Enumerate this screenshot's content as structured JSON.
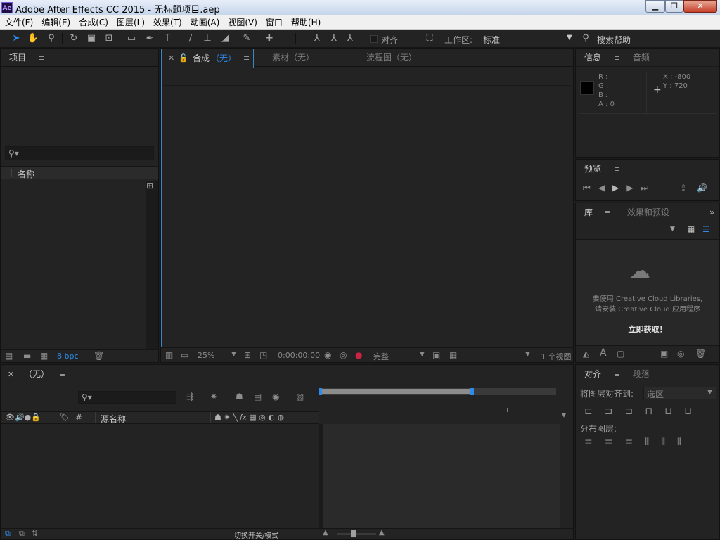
{
  "window": {
    "logo": "Ae",
    "title": "Adobe After Effects CC 2015 - 无标题项目.aep"
  },
  "menu": [
    "文件(F)",
    "编辑(E)",
    "合成(C)",
    "图层(L)",
    "效果(T)",
    "动画(A)",
    "视图(V)",
    "窗口",
    "帮助(H)"
  ],
  "toolbar": {
    "snap_label": "对齐",
    "workspace_label": "工作区:",
    "workspace_value": "标准",
    "search_placeholder": "搜索帮助"
  },
  "project": {
    "title": "项目",
    "col_name": "名称",
    "bpc": "8 bpc"
  },
  "viewer": {
    "tabs": [
      {
        "label": "合成",
        "suffix": "（无）"
      },
      {
        "label": "素材（无）"
      },
      {
        "label": "流程图（无）"
      }
    ],
    "zoom": "25%",
    "timecode": "0:00:00:00",
    "resolution": "完整",
    "views": "1 个视图"
  },
  "info": {
    "tabs": [
      "信息",
      "音频"
    ],
    "r": "R :",
    "g": "G :",
    "b": "B :",
    "a": "A : 0",
    "x": "X : -800",
    "y": "Y : 720"
  },
  "preview": {
    "title": "预览"
  },
  "library": {
    "tabs": [
      "库",
      "效果和预设"
    ],
    "message_line1": "要使用 Creative Cloud Libraries,",
    "message_line2": "请安装 Creative Cloud 应用程序",
    "link": "立即获取！"
  },
  "timeline": {
    "title": "（无）",
    "col_hash": "#",
    "col_source": "源名称",
    "footer_toggle": "切换开关/模式"
  },
  "align": {
    "tabs": [
      "对齐",
      "段落"
    ],
    "align_to_label": "将图层对齐到:",
    "align_to_value": "选区",
    "distribute_label": "分布图层:"
  },
  "colors": {
    "bg": "#232323",
    "accent": "#2d8ceb",
    "viewer_frame": "#3b8ac8"
  }
}
